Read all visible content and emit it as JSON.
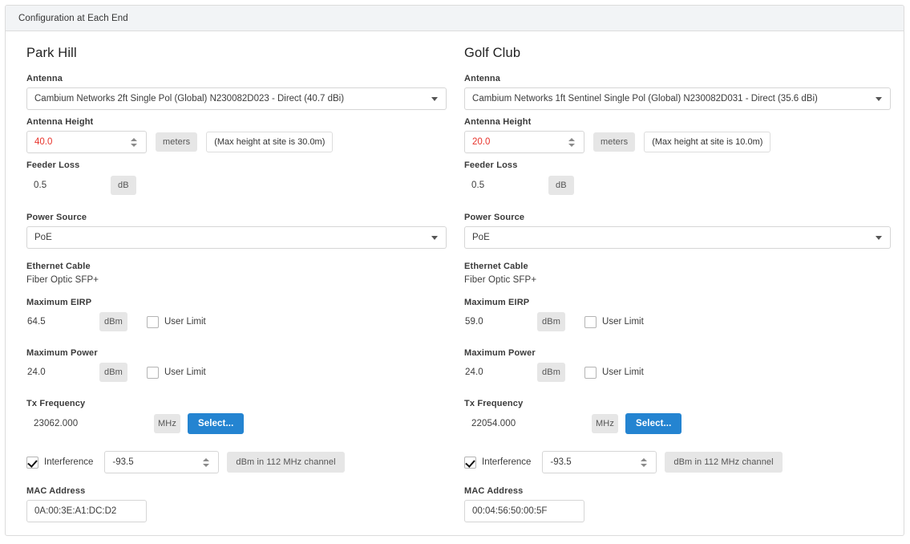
{
  "header": {
    "title": "Configuration at Each End"
  },
  "common": {
    "labels": {
      "antenna": "Antenna",
      "antenna_height": "Antenna Height",
      "feeder_loss": "Feeder Loss",
      "power_source": "Power Source",
      "ethernet_cable": "Ethernet Cable",
      "maximum_eirp": "Maximum EIRP",
      "maximum_power": "Maximum Power",
      "tx_frequency": "Tx Frequency",
      "interference": "Interference",
      "mac_address": "MAC Address",
      "user_limit": "User Limit"
    },
    "units": {
      "meters": "meters",
      "db": "dB",
      "dbm": "dBm",
      "mhz": "MHz",
      "interference_unit": "dBm in 112 MHz channel"
    },
    "buttons": {
      "select": "Select..."
    },
    "accent_color": "#2484d1",
    "error_color": "#e8322a"
  },
  "ends": [
    {
      "title": "Park Hill",
      "antenna": "Cambium Networks 2ft Single Pol (Global) N230082D023 - Direct (40.7 dBi)",
      "antenna_height": "40.0",
      "antenna_height_hint": "(Max height at site is 30.0m)",
      "antenna_height_is_error": true,
      "feeder_loss": "0.5",
      "power_source": "PoE",
      "ethernet_cable": "Fiber Optic SFP+",
      "maximum_eirp": "64.5",
      "maximum_eirp_user_limit_checked": false,
      "maximum_power": "24.0",
      "maximum_power_user_limit_checked": false,
      "tx_frequency": "23062.000",
      "interference_checked": true,
      "interference_value": "-93.5",
      "mac_address": "0A:00:3E:A1:DC:D2"
    },
    {
      "title": "Golf Club",
      "antenna": "Cambium Networks 1ft Sentinel Single Pol (Global) N230082D031 - Direct (35.6 dBi)",
      "antenna_height": "20.0",
      "antenna_height_hint": "(Max height at site is 10.0m)",
      "antenna_height_is_error": true,
      "feeder_loss": "0.5",
      "power_source": "PoE",
      "ethernet_cable": "Fiber Optic SFP+",
      "maximum_eirp": "59.0",
      "maximum_eirp_user_limit_checked": false,
      "maximum_power": "24.0",
      "maximum_power_user_limit_checked": false,
      "tx_frequency": "22054.000",
      "interference_checked": true,
      "interference_value": "-93.5",
      "mac_address": "00:04:56:50:00:5F"
    }
  ]
}
